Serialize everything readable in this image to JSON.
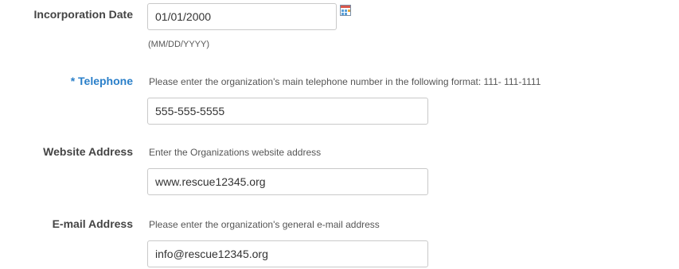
{
  "incorporation": {
    "label": "Incorporation Date",
    "value": "01/01/2000",
    "format_hint": "(MM/DD/YYYY)",
    "icon": "calendar-icon"
  },
  "telephone": {
    "required_marker": "*",
    "label": "* Telephone",
    "help": "Please enter the organization's main telephone number in the following format: 111- 111-1111",
    "value": "555-555-5555"
  },
  "website": {
    "label": "Website Address",
    "help": "Enter the Organizations website address",
    "value": "www.rescue12345.org"
  },
  "email": {
    "label": "E-mail Address",
    "help": "Please enter the organization's general e-mail address",
    "value": "info@rescue12345.org"
  },
  "colors": {
    "required_label": "#2a7fc9",
    "label": "#444444",
    "input_border": "#c9c9c9"
  }
}
